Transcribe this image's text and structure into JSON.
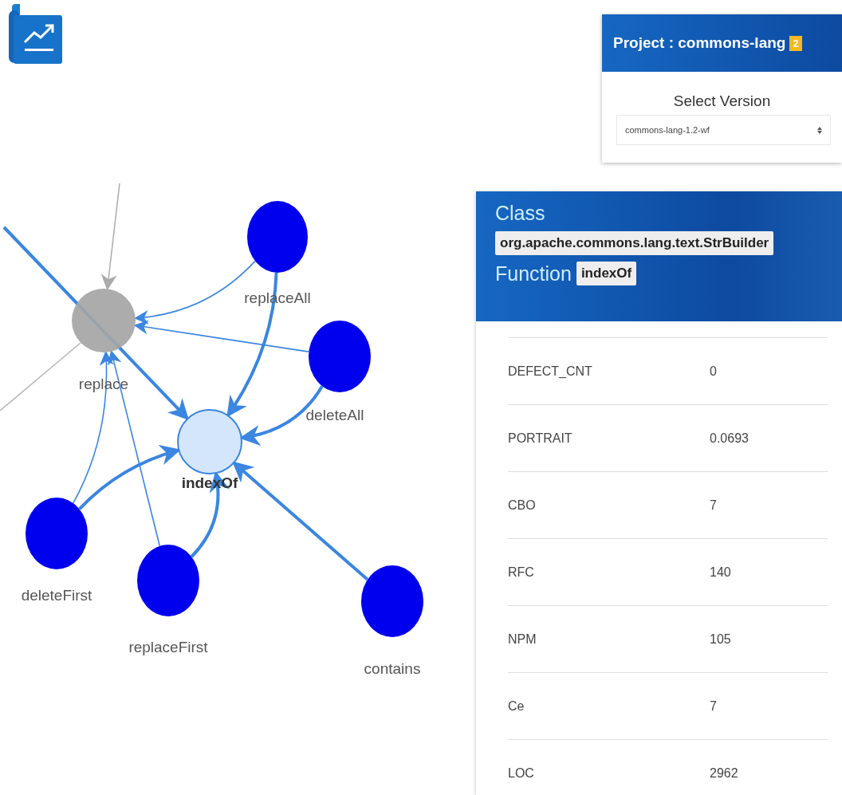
{
  "project": {
    "title": "Project : commons-lang",
    "badge": "2",
    "version_label": "Select Version",
    "version": "commons-lang-1.2-wf"
  },
  "graph": {
    "nodes": [
      {
        "name": "replace",
        "kind": "other"
      },
      {
        "name": "replaceAll",
        "kind": "caller"
      },
      {
        "name": "deleteAll",
        "kind": "caller"
      },
      {
        "name": "indexOf",
        "kind": "focus"
      },
      {
        "name": "deleteFirst",
        "kind": "caller"
      },
      {
        "name": "replaceFirst",
        "kind": "caller"
      },
      {
        "name": "contains",
        "kind": "caller"
      }
    ]
  },
  "details": {
    "class_label": "Class",
    "class_name": "org.apache.commons.lang.text.StrBuilder",
    "function_label": "Function",
    "function_name": "indexOf",
    "metrics": [
      {
        "name": "DEFECT_CNT",
        "value": "0"
      },
      {
        "name": "PORTRAIT",
        "value": "0.0693"
      },
      {
        "name": "CBO",
        "value": "7"
      },
      {
        "name": "RFC",
        "value": "140"
      },
      {
        "name": "NPM",
        "value": "105"
      },
      {
        "name": "Ce",
        "value": "7"
      },
      {
        "name": "LOC",
        "value": "2962"
      }
    ]
  }
}
